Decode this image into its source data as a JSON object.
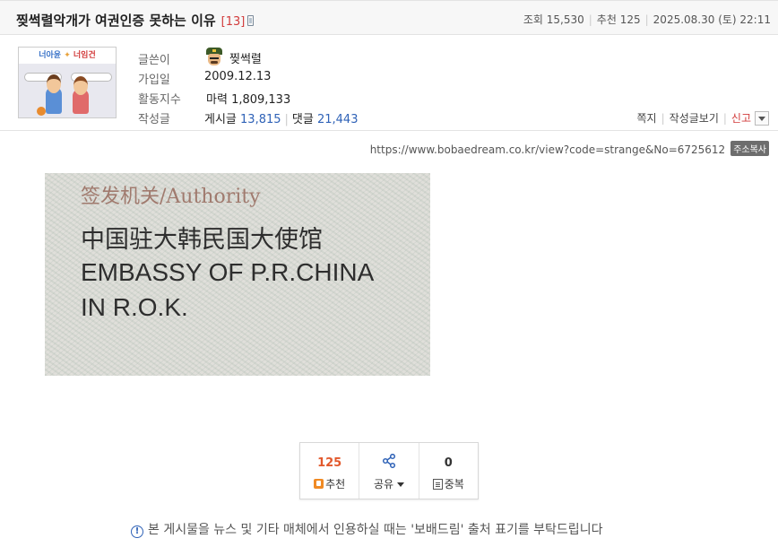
{
  "post": {
    "title": "찢썩렬악개가 여권인증 못하는 이유",
    "comment_count": "[13]",
    "views_label": "조회",
    "views": "15,530",
    "recommend_label": "추천",
    "recommend": "125",
    "datetime": "2025.08.30 (토) 22:11"
  },
  "profile": {
    "image_banner_left": "너아윤",
    "image_banner_right": "너임건",
    "author_label": "글쓴이",
    "author": "찢썩렬",
    "joined_label": "가입일",
    "joined": "2009.12.13",
    "activity_label": "활동지수",
    "activity_prefix": "마력",
    "activity_value": "1,809,133",
    "posts_label": "작성글",
    "posts_prefix": "게시글",
    "posts_count": "13,815",
    "comments_prefix": "댓글",
    "comments_count": "21,443",
    "actions": {
      "message": "쪽지",
      "view_posts": "작성글보기",
      "report": "신고"
    }
  },
  "url": {
    "text": "https://www.bobaedream.co.kr/view?code=strange&No=6725612",
    "copy_label": "주소복사"
  },
  "image_text": {
    "line1": "签发机关/Authority",
    "line2": "中国驻大韩民国大使馆",
    "line3": "EMBASSY OF P.R.CHINA",
    "line4": "IN R.O.K."
  },
  "votes": {
    "recommend_count": "125",
    "recommend_label": "추천",
    "share_label": "공유",
    "duplicate_count": "0",
    "duplicate_label": "중복"
  },
  "notice": {
    "text": "본 게시물을 뉴스 및 기타 매체에서 인용하실 때는 '보배드림' 출처 표기를 부탁드립니다"
  },
  "colors": {
    "accent_red": "#d23b3b",
    "link_blue": "#2f62b7",
    "vote_orange": "#e2582b"
  }
}
